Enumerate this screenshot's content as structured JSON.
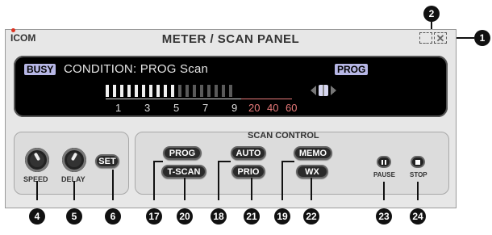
{
  "window": {
    "logo": "ICOM",
    "title": "METER / SCAN PANEL",
    "minimize_label": "_",
    "close_label": "✕"
  },
  "meter": {
    "busy_label": "BUSY",
    "condition_text": "CONDITION: PROG Scan",
    "prog_indicator": "PROG",
    "signal_level_lit_segments": 10,
    "total_segments": 18,
    "scale_labels": [
      "1",
      "3",
      "5",
      "7",
      "9",
      "20",
      "40",
      "60"
    ]
  },
  "controls": {
    "speed_label": "SPEED",
    "delay_label": "DELAY",
    "set_button": "SET"
  },
  "scan_control": {
    "group_label": "SCAN CONTROL",
    "buttons": {
      "prog": "PROG",
      "tscan": "T-SCAN",
      "auto": "AUTO",
      "prio": "PRIO",
      "memo": "MEMO",
      "wx": "WX"
    },
    "pause_label": "PAUSE",
    "stop_label": "STOP"
  },
  "callouts": {
    "c1": "1",
    "c2": "2",
    "c4": "4",
    "c5": "5",
    "c6": "6",
    "c17": "17",
    "c18": "18",
    "c19": "19",
    "c20": "20",
    "c21": "21",
    "c22": "22",
    "c23": "23",
    "c24": "24"
  },
  "colors": {
    "display_bg": "#000000",
    "indicator_bg": "#b7b7e6",
    "bar_lit": "#f0f0f0",
    "bar_unlit": "#5a5a5a",
    "scale_red": "#e87a7a"
  }
}
